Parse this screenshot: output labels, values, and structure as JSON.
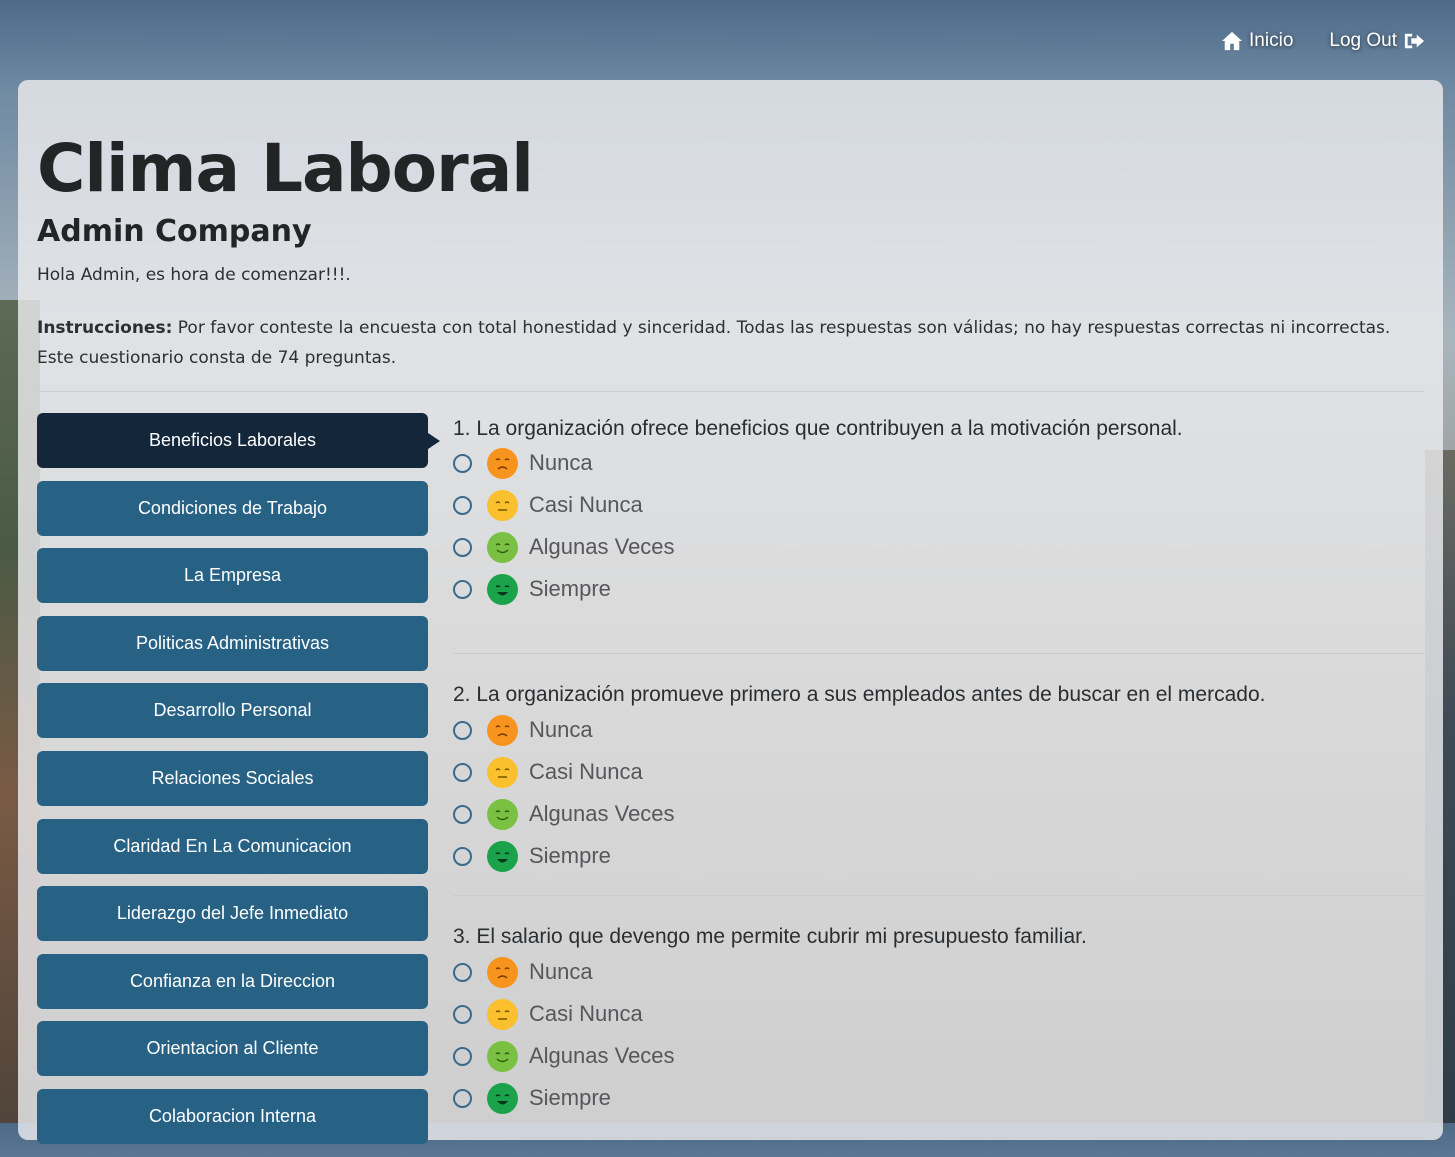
{
  "nav": {
    "home_label": "Inicio",
    "logout_label": "Log Out"
  },
  "header": {
    "title": "Clima Laboral",
    "company": "Admin Company",
    "greeting": "Hola Admin, es hora de comenzar!!!.",
    "instructions_label": "Instrucciones:",
    "instructions_text": " Por favor conteste la encuesta con total honestidad y sinceridad. Todas las respuestas son válidas; no hay respuestas correctas ni incorrectas. Este cuestionario consta de 74 preguntas."
  },
  "sidebar": {
    "items": [
      {
        "label": "Beneficios Laborales",
        "active": true
      },
      {
        "label": "Condiciones de Trabajo"
      },
      {
        "label": "La Empresa"
      },
      {
        "label": "Politicas Administrativas"
      },
      {
        "label": "Desarrollo Personal"
      },
      {
        "label": "Relaciones Sociales"
      },
      {
        "label": "Claridad En La Comunicacion"
      },
      {
        "label": "Liderazgo del Jefe Inmediato"
      },
      {
        "label": "Confianza en la Direccion"
      },
      {
        "label": "Orientacion al Cliente"
      },
      {
        "label": "Colaboracion Interna"
      }
    ]
  },
  "options": [
    {
      "label": "Nunca",
      "face": "angry-face-icon",
      "color": "#f7941d"
    },
    {
      "label": "Casi Nunca",
      "face": "neutral-face-icon",
      "color": "#fbc02d"
    },
    {
      "label": "Algunas Veces",
      "face": "smile-face-icon",
      "color": "#7ac143"
    },
    {
      "label": "Siempre",
      "face": "happy-face-icon",
      "color": "#1aa34a"
    }
  ],
  "questions": [
    {
      "text": "1. La organización ofrece beneficios que contribuyen a la motivación personal."
    },
    {
      "text": "2. La organización promueve primero a sus empleados antes de buscar en el mercado."
    },
    {
      "text": "3. El salario que devengo me permite cubrir mi presupuesto familiar."
    }
  ],
  "colors": {
    "button": "#276285",
    "button_active": "#13263a"
  }
}
